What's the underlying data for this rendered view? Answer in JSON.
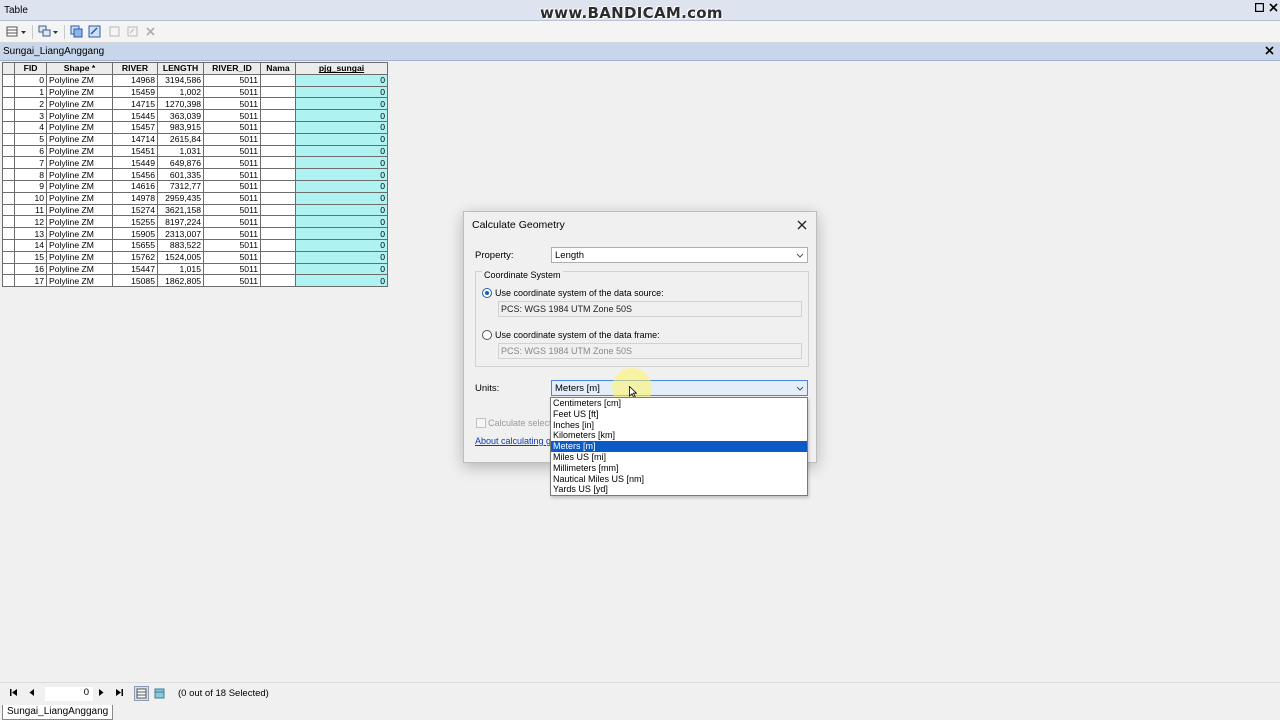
{
  "window": {
    "title": "Table",
    "watermark": "www.BANDICAM.com"
  },
  "tab": {
    "name": "Sungai_LiangAnggang"
  },
  "table": {
    "columns": [
      "FID",
      "Shape *",
      "RIVER",
      "LENGTH",
      "RIVER_ID",
      "Nama",
      "pjg_sungai"
    ],
    "rows": [
      [
        "0",
        "Polyline ZM",
        "14968",
        "3194,586",
        "5011",
        "",
        "0"
      ],
      [
        "1",
        "Polyline ZM",
        "15459",
        "1,002",
        "5011",
        "",
        "0"
      ],
      [
        "2",
        "Polyline ZM",
        "14715",
        "1270,398",
        "5011",
        "",
        "0"
      ],
      [
        "3",
        "Polyline ZM",
        "15445",
        "363,039",
        "5011",
        "",
        "0"
      ],
      [
        "4",
        "Polyline ZM",
        "15457",
        "983,915",
        "5011",
        "",
        "0"
      ],
      [
        "5",
        "Polyline ZM",
        "14714",
        "2615,84",
        "5011",
        "",
        "0"
      ],
      [
        "6",
        "Polyline ZM",
        "15451",
        "1,031",
        "5011",
        "",
        "0"
      ],
      [
        "7",
        "Polyline ZM",
        "15449",
        "649,876",
        "5011",
        "",
        "0"
      ],
      [
        "8",
        "Polyline ZM",
        "15456",
        "601,335",
        "5011",
        "",
        "0"
      ],
      [
        "9",
        "Polyline ZM",
        "14616",
        "7312,77",
        "5011",
        "",
        "0"
      ],
      [
        "10",
        "Polyline ZM",
        "14978",
        "2959,435",
        "5011",
        "",
        "0"
      ],
      [
        "11",
        "Polyline ZM",
        "15274",
        "3621,158",
        "5011",
        "",
        "0"
      ],
      [
        "12",
        "Polyline ZM",
        "15255",
        "8197,224",
        "5011",
        "",
        "0"
      ],
      [
        "13",
        "Polyline ZM",
        "15905",
        "2313,007",
        "5011",
        "",
        "0"
      ],
      [
        "14",
        "Polyline ZM",
        "15655",
        "883,522",
        "5011",
        "",
        "0"
      ],
      [
        "15",
        "Polyline ZM",
        "15762",
        "1524,005",
        "5011",
        "",
        "0"
      ],
      [
        "16",
        "Polyline ZM",
        "15447",
        "1,015",
        "5011",
        "",
        "0"
      ],
      [
        "17",
        "Polyline ZM",
        "15085",
        "1862,805",
        "5011",
        "",
        "0"
      ]
    ]
  },
  "dialog": {
    "title": "Calculate Geometry",
    "property_label": "Property:",
    "property_value": "Length",
    "coord_group_label": "Coordinate System",
    "radio_source_label": "Use coordinate system of the data source:",
    "source_cs": "PCS: WGS 1984 UTM Zone 50S",
    "radio_frame_label": "Use coordinate system of the data frame:",
    "frame_cs": "PCS: WGS 1984 UTM Zone 50S",
    "units_label": "Units:",
    "units_value": "Meters [m]",
    "calc_selected_label": "Calculate selecte",
    "about_link": "About calculating g",
    "units_options": [
      "Centimeters [cm]",
      "Feet US [ft]",
      "Inches [in]",
      "Kilometers [km]",
      "Meters [m]",
      "Miles US [mi]",
      "Millimeters [mm]",
      "Nautical Miles US [nm]",
      "Yards US [yd]"
    ],
    "selected_unit_index": 4
  },
  "status": {
    "record": "0",
    "selection": "(0 out of 18 Selected)"
  },
  "bottom_tab": "Sungai_LiangAnggang",
  "colors": {
    "selected": "#0a5bc8",
    "field_highlight": "#aef2f2"
  }
}
